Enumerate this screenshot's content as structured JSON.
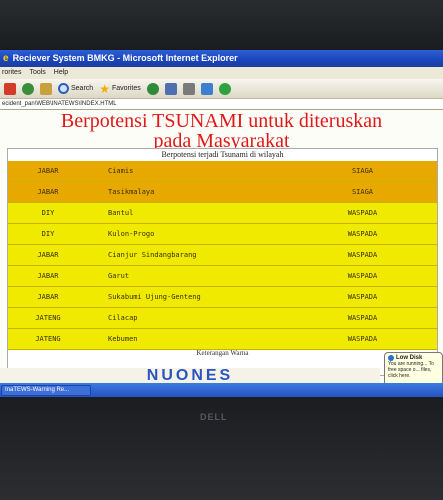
{
  "window": {
    "title": "Reciever System BMKG - Microsoft Internet Explorer"
  },
  "menu": [
    "rorites",
    "Tools",
    "Help"
  ],
  "toolbar": {
    "search_label": "Search",
    "favorites_label": "Favorites"
  },
  "address": "ecident_pan\\WEB\\INATEWS\\INDEX.HTML",
  "page": {
    "heading_line1": "Berpotensi TSUNAMI untuk diteruskan",
    "heading_line2": "pada Masyarakat",
    "table_caption": "Berpotensi terjadi Tsunami di wilayah",
    "footer_caption": "Keterangan Warna",
    "rows": [
      {
        "province": "JABAR",
        "district": "Ciamis",
        "status": "SIAGA",
        "level": "siaga"
      },
      {
        "province": "JABAR",
        "district": "Tasikmalaya",
        "status": "SIAGA",
        "level": "siaga"
      },
      {
        "province": "DIY",
        "district": "Bantul",
        "status": "WASPADA",
        "level": "waspada"
      },
      {
        "province": "DIY",
        "district": "Kulon-Progo",
        "status": "WASPADA",
        "level": "waspada"
      },
      {
        "province": "JABAR",
        "district": "Cianjur Sindangbarang",
        "status": "WASPADA",
        "level": "waspada"
      },
      {
        "province": "JABAR",
        "district": "Garut",
        "status": "WASPADA",
        "level": "waspada"
      },
      {
        "province": "JABAR",
        "district": "Sukabumi Ujung-Genteng",
        "status": "WASPADA",
        "level": "waspada"
      },
      {
        "province": "JATENG",
        "district": "Cilacap",
        "status": "WASPADA",
        "level": "waspada"
      },
      {
        "province": "JATENG",
        "district": "Kebumen",
        "status": "WASPADA",
        "level": "waspada"
      }
    ]
  },
  "logo_text": "NUONES",
  "taskbar": {
    "task_label": "InaTEWS-Warning Re..."
  },
  "balloon": {
    "title": "Low Disk",
    "body": "You are running... To free space o... files, click here."
  },
  "monitor_brand": "DELL",
  "colors": {
    "heading_red": "#e01818",
    "siaga_orange": "#e7a800",
    "waspada_yellow": "#f0ea00",
    "titlebar_blue": "#1a44b8"
  }
}
